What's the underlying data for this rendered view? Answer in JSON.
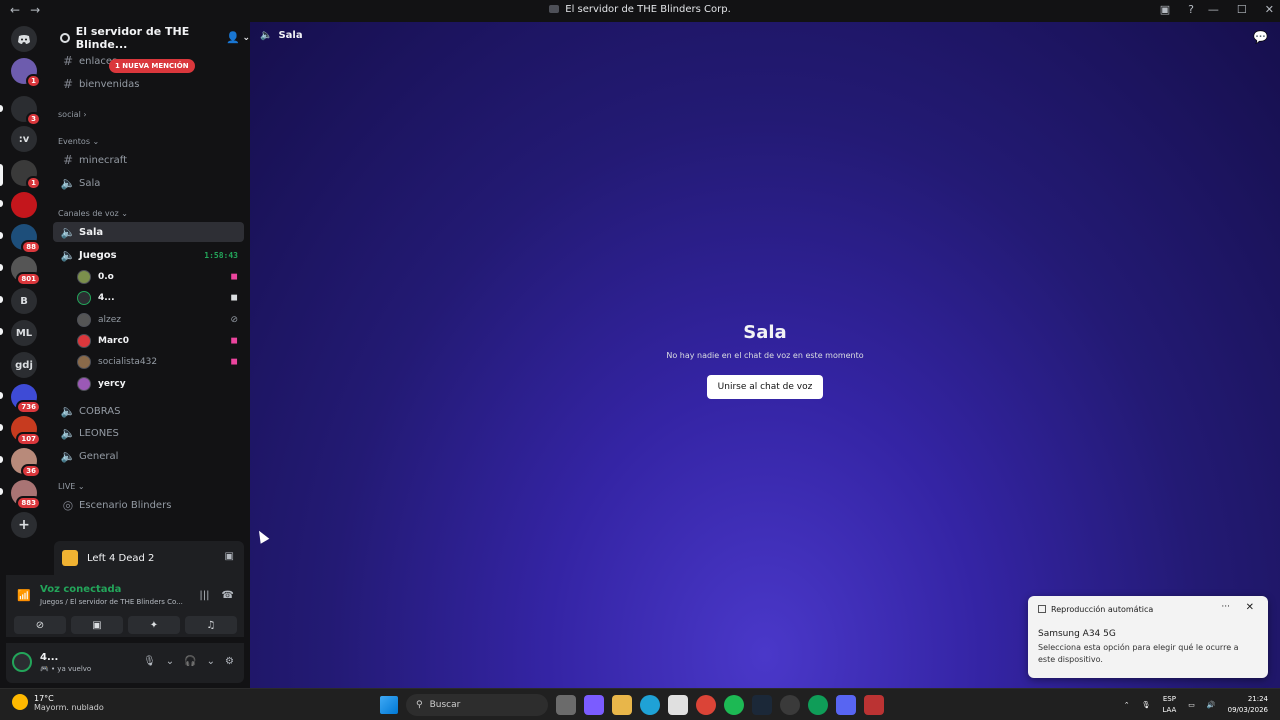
{
  "window": {
    "title": "El servidor de THE Blinders Corp."
  },
  "guilds": [
    {
      "label": "",
      "badge": "1"
    },
    {
      "label": "",
      "badge": "3"
    },
    {
      "label": ":v",
      "badge": ""
    },
    {
      "label": "",
      "badge": "1"
    },
    {
      "label": "",
      "badge": ""
    },
    {
      "label": "",
      "badge": "88"
    },
    {
      "label": "",
      "badge": "801"
    },
    {
      "label": "B",
      "badge": ""
    },
    {
      "label": "ML",
      "badge": ""
    },
    {
      "label": "gdj",
      "badge": ""
    },
    {
      "label": "",
      "badge": "736"
    },
    {
      "label": "",
      "badge": "107"
    },
    {
      "label": "",
      "badge": "36"
    },
    {
      "label": "",
      "badge": "883"
    }
  ],
  "server": {
    "name": "El servidor de THE Blinde..."
  },
  "mention_pill": "1 NUEVA MENCIÓN",
  "channels": {
    "enlaces": "enlaces",
    "bienvenidas": "bienvenidas",
    "cat_social": "social",
    "cat_eventos": "Eventos",
    "minecraft": "minecraft",
    "sala_evento": "Sala",
    "cat_voz": "Canales de voz",
    "sala": "Sala",
    "juegos": "Juegos",
    "juegos_time": "1:58:43",
    "cobras": "COBRAS",
    "leones": "LEONES",
    "general": "General",
    "cat_live": "LIVE",
    "escenario": "Escenario Blinders"
  },
  "voice_users": [
    {
      "name": "0.o"
    },
    {
      "name": "4..."
    },
    {
      "name": "alzez"
    },
    {
      "name": "Marc0"
    },
    {
      "name": "socialista432"
    },
    {
      "name": "yercy"
    }
  ],
  "activity": {
    "game": "Left 4 Dead 2"
  },
  "voice": {
    "status": "Voz conectada",
    "location": "Juegos / El servidor de THE Blinders Co..."
  },
  "user": {
    "name": "4...",
    "status": "ya vuelvo"
  },
  "main": {
    "channel": "Sala",
    "heading": "Sala",
    "subtext": "No hay nadie en el chat de voz en este momento",
    "join_button": "Unirse al chat de voz"
  },
  "toast": {
    "header": "Reproducción automática",
    "device": "Samsung A34 5G",
    "body": "Selecciona esta opción para elegir qué le ocurre a este dispositivo."
  },
  "taskbar": {
    "temp": "17°C",
    "weather": "Mayorm. nublado",
    "search": "Buscar",
    "lang1": "ESP",
    "lang2": "LAA",
    "time": "21:24",
    "date": "09/03/2026"
  }
}
